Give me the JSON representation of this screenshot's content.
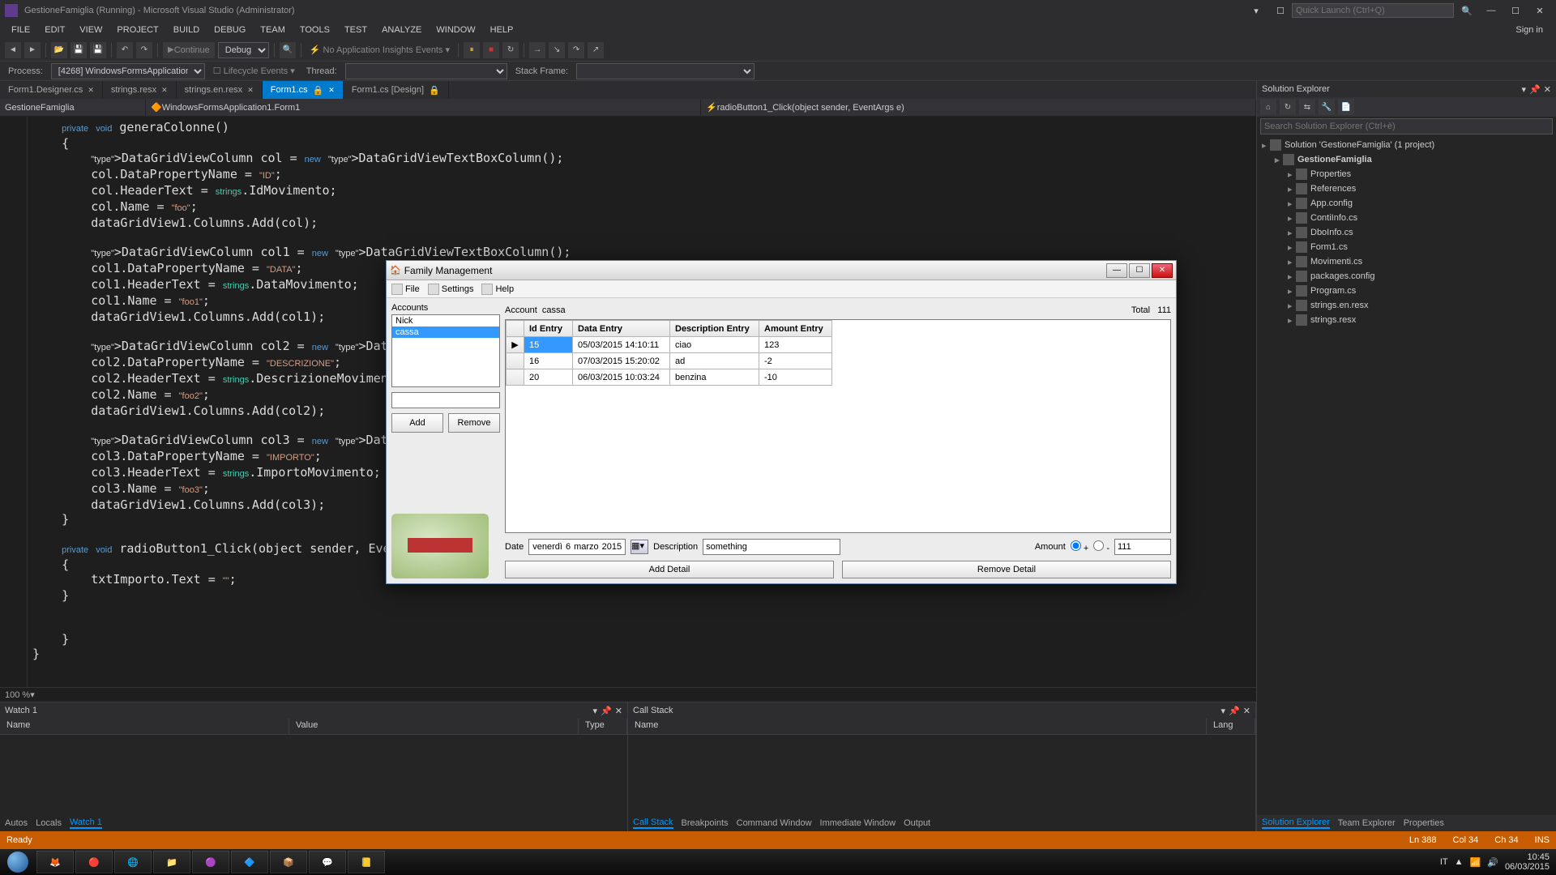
{
  "app": {
    "title": "GestioneFamiglia (Running) - Microsoft Visual Studio (Administrator)",
    "quick_launch_ph": "Quick Launch (Ctrl+Q)",
    "sign_in": "Sign in"
  },
  "menu": [
    "FILE",
    "EDIT",
    "VIEW",
    "PROJECT",
    "BUILD",
    "DEBUG",
    "TEAM",
    "TOOLS",
    "TEST",
    "ANALYZE",
    "WINDOW",
    "HELP"
  ],
  "toolbar": {
    "continue": "Continue",
    "configuration": "Debug",
    "no_insights": "No Application Insights Events"
  },
  "toolbar2": {
    "process_label": "Process:",
    "process_value": "[4268] WindowsFormsApplication.",
    "lifecycle": "Lifecycle Events",
    "thread_label": "Thread:",
    "stack_frame": "Stack Frame:"
  },
  "tabs": [
    {
      "label": "Form1.Designer.cs",
      "close": true
    },
    {
      "label": "strings.resx",
      "close": true
    },
    {
      "label": "strings.en.resx",
      "close": true
    },
    {
      "label": "Form1.cs",
      "close": true,
      "active": true,
      "locked": true
    },
    {
      "label": "Form1.cs [Design]",
      "close": true,
      "locked": true
    }
  ],
  "nav": {
    "left": "GestioneFamiglia",
    "mid": "WindowsFormsApplication1.Form1",
    "right": "radioButton1_Click(object sender, EventArgs e)"
  },
  "code": "    private void generaColonne()\n    {\n        DataGridViewColumn col = new DataGridViewTextBoxColumn();\n        col.DataPropertyName = \"ID\";\n        col.HeaderText = strings.IdMovimento;\n        col.Name = \"foo\";\n        dataGridView1.Columns.Add(col);\n\n        DataGridViewColumn col1 = new DataGridViewTextBoxColumn();\n        col1.DataPropertyName = \"DATA\";\n        col1.HeaderText = strings.DataMovimento;\n        col1.Name = \"foo1\";\n        dataGridView1.Columns.Add(col1);\n\n        DataGridViewColumn col2 = new DataGridViewTextBo\n        col2.DataPropertyName = \"DESCRIZIONE\";\n        col2.HeaderText = strings.DescrizioneMovimento;\n        col2.Name = \"foo2\";\n        dataGridView1.Columns.Add(col2);\n\n        DataGridViewColumn col3 = new DataGridViewTextBo\n        col3.DataPropertyName = \"IMPORTO\";\n        col3.HeaderText = strings.ImportoMovimento;\n        col3.Name = \"foo3\";\n        dataGridView1.Columns.Add(col3);\n    }\n\n    private void radioButton1_Click(object sender, Event\n    {\n        txtImporto.Text = \"\";\n    }\n\n\n    }\n}",
  "zoom": "100 %",
  "watch": {
    "title": "Watch 1",
    "columns": [
      "Name",
      "Value",
      "Type"
    ]
  },
  "callstack": {
    "title": "Call Stack",
    "columns": [
      "Name",
      "Lang"
    ]
  },
  "editor_bottom_tabs": [
    "Autos",
    "Locals",
    "Watch 1"
  ],
  "callstack_tabs": [
    "Call Stack",
    "Breakpoints",
    "Command Window",
    "Immediate Window",
    "Output"
  ],
  "solution": {
    "title": "Solution Explorer",
    "search_ph": "Search Solution Explorer (Ctrl+è)",
    "nodes": [
      {
        "label": "Solution 'GestioneFamiglia' (1 project)",
        "depth": 0
      },
      {
        "label": "GestioneFamiglia",
        "depth": 1,
        "bold": true
      },
      {
        "label": "Properties",
        "depth": 2
      },
      {
        "label": "References",
        "depth": 2
      },
      {
        "label": "App.config",
        "depth": 2
      },
      {
        "label": "ContiInfo.cs",
        "depth": 2
      },
      {
        "label": "DboInfo.cs",
        "depth": 2
      },
      {
        "label": "Form1.cs",
        "depth": 2
      },
      {
        "label": "Movimenti.cs",
        "depth": 2
      },
      {
        "label": "packages.config",
        "depth": 2
      },
      {
        "label": "Program.cs",
        "depth": 2
      },
      {
        "label": "strings.en.resx",
        "depth": 2
      },
      {
        "label": "strings.resx",
        "depth": 2
      }
    ],
    "tabs": [
      "Solution Explorer",
      "Team Explorer",
      "Properties"
    ]
  },
  "status": {
    "ready": "Ready",
    "ln": "Ln 388",
    "col": "Col 34",
    "ch": "Ch 34",
    "ins": "INS"
  },
  "tray": {
    "lang": "IT",
    "time": "10:45",
    "date": "06/03/2015"
  },
  "dialog": {
    "title": "Family Management",
    "menu": [
      "File",
      "Settings",
      "Help"
    ],
    "accounts_label": "Accounts",
    "accounts": [
      "Nick",
      "cassa"
    ],
    "selected_account": "cassa",
    "add": "Add",
    "remove": "Remove",
    "account_label": "Account",
    "account_value": "cassa",
    "total_label": "Total",
    "total_value": "111",
    "grid_headers": [
      "Id Entry",
      "Data Entry",
      "Description Entry",
      "Amount Entry"
    ],
    "grid_rows": [
      {
        "id": "15",
        "date": "05/03/2015 14:10:11",
        "desc": "ciao",
        "amount": "123",
        "sel": true
      },
      {
        "id": "16",
        "date": "07/03/2015 15:20:02",
        "desc": "ad",
        "amount": "-2"
      },
      {
        "id": "20",
        "date": "06/03/2015 10:03:24",
        "desc": "benzina",
        "amount": "-10"
      }
    ],
    "date_label": "Date",
    "date_parts": {
      "weekday": "venerdì",
      "day": "6",
      "month": "marzo",
      "year": "2015"
    },
    "desc_label": "Description",
    "desc_value": "something",
    "amount_label": "Amount",
    "amount_value": "111",
    "plus": "+",
    "minus": "-",
    "add_detail": "Add Detail",
    "remove_detail": "Remove Detail"
  }
}
